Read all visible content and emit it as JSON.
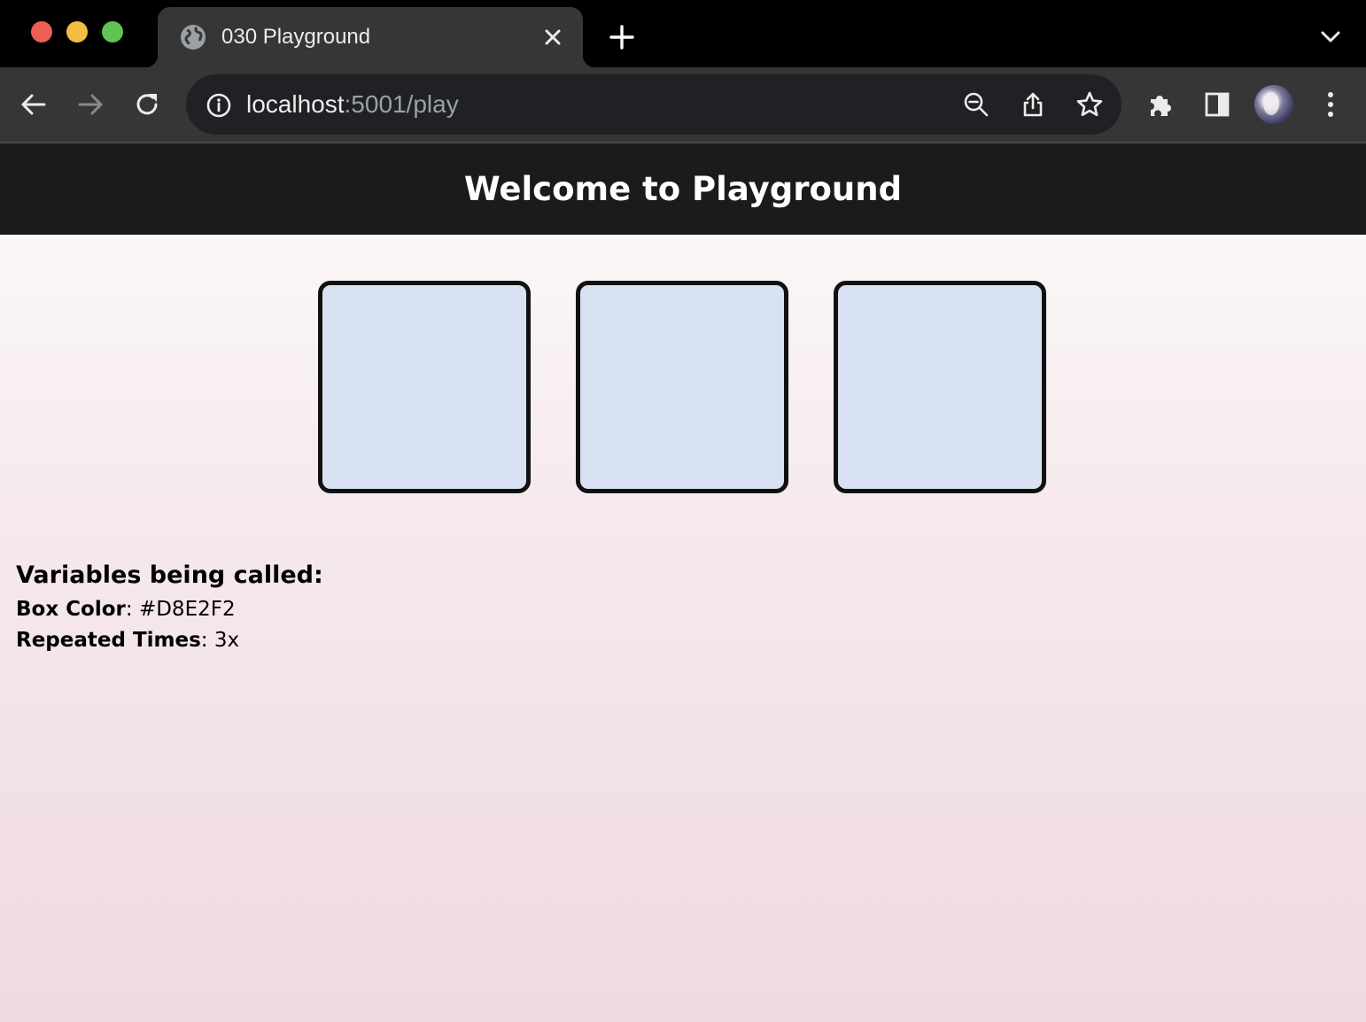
{
  "browser": {
    "tab": {
      "title": "030 Playground"
    },
    "address_bar": {
      "host": "localhost",
      "rest": ":5001/play"
    }
  },
  "page": {
    "header_title": "Welcome to Playground",
    "box_color": "#D8E2F2",
    "box_count": 3,
    "variables": {
      "heading": "Variables being called:",
      "box_color_label": "Box Color",
      "box_color_value": ": #D8E2F2",
      "repeated_label": "Repeated Times",
      "repeated_value": ": 3x"
    }
  }
}
